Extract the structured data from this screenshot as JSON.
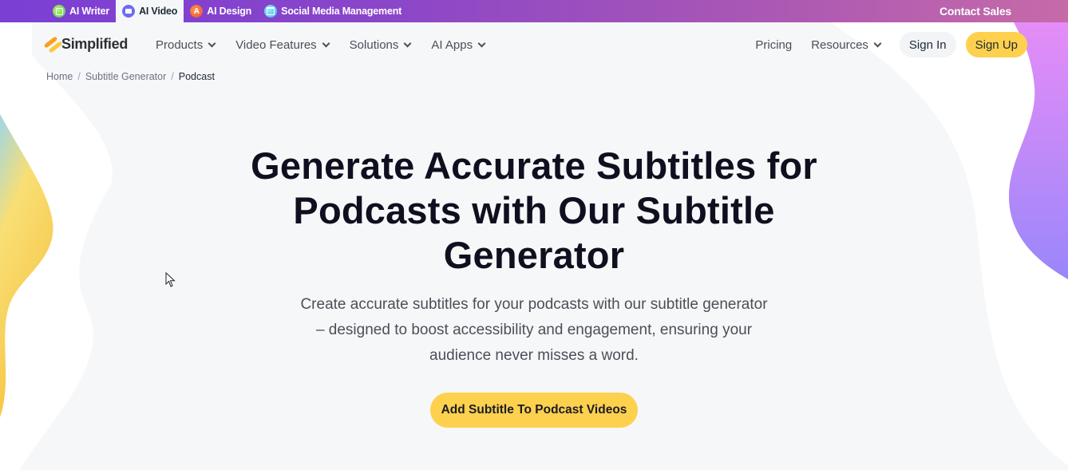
{
  "topbar": {
    "products": [
      {
        "label": "AI Writer",
        "icon": "ai-writer-icon",
        "active": false
      },
      {
        "label": "AI Video",
        "icon": "ai-video-icon",
        "active": true
      },
      {
        "label": "AI Design",
        "icon": "ai-design-icon",
        "active": false
      },
      {
        "label": "Social Media Management",
        "icon": "calendar-icon",
        "active": false
      }
    ],
    "contact_sales": "Contact Sales"
  },
  "navbar": {
    "logo_text": "Simplified",
    "left_items": [
      {
        "label": "Products",
        "has_dropdown": true
      },
      {
        "label": "Video Features",
        "has_dropdown": true
      },
      {
        "label": "Solutions",
        "has_dropdown": true
      },
      {
        "label": "AI Apps",
        "has_dropdown": true
      }
    ],
    "pricing": "Pricing",
    "resources": "Resources",
    "sign_in": "Sign In",
    "sign_up": "Sign Up"
  },
  "breadcrumb": {
    "items": [
      "Home",
      "Subtitle Generator",
      "Podcast"
    ],
    "separator": "/"
  },
  "hero": {
    "title": "Generate Accurate Subtitles for Podcasts with Our Subtitle Generator",
    "subtitle": "Create accurate subtitles for your podcasts with our subtitle generator – designed to boost accessibility and engagement, ensuring your audience never misses a word.",
    "cta_label": "Add Subtitle To Podcast Videos"
  },
  "colors": {
    "accent_yellow": "#fdd14e",
    "topbar_purple": "#7b3fd4",
    "topbar_pink": "#c66aa8",
    "page_bg": "#f6f7f9",
    "title_text": "#0f0f1f"
  }
}
